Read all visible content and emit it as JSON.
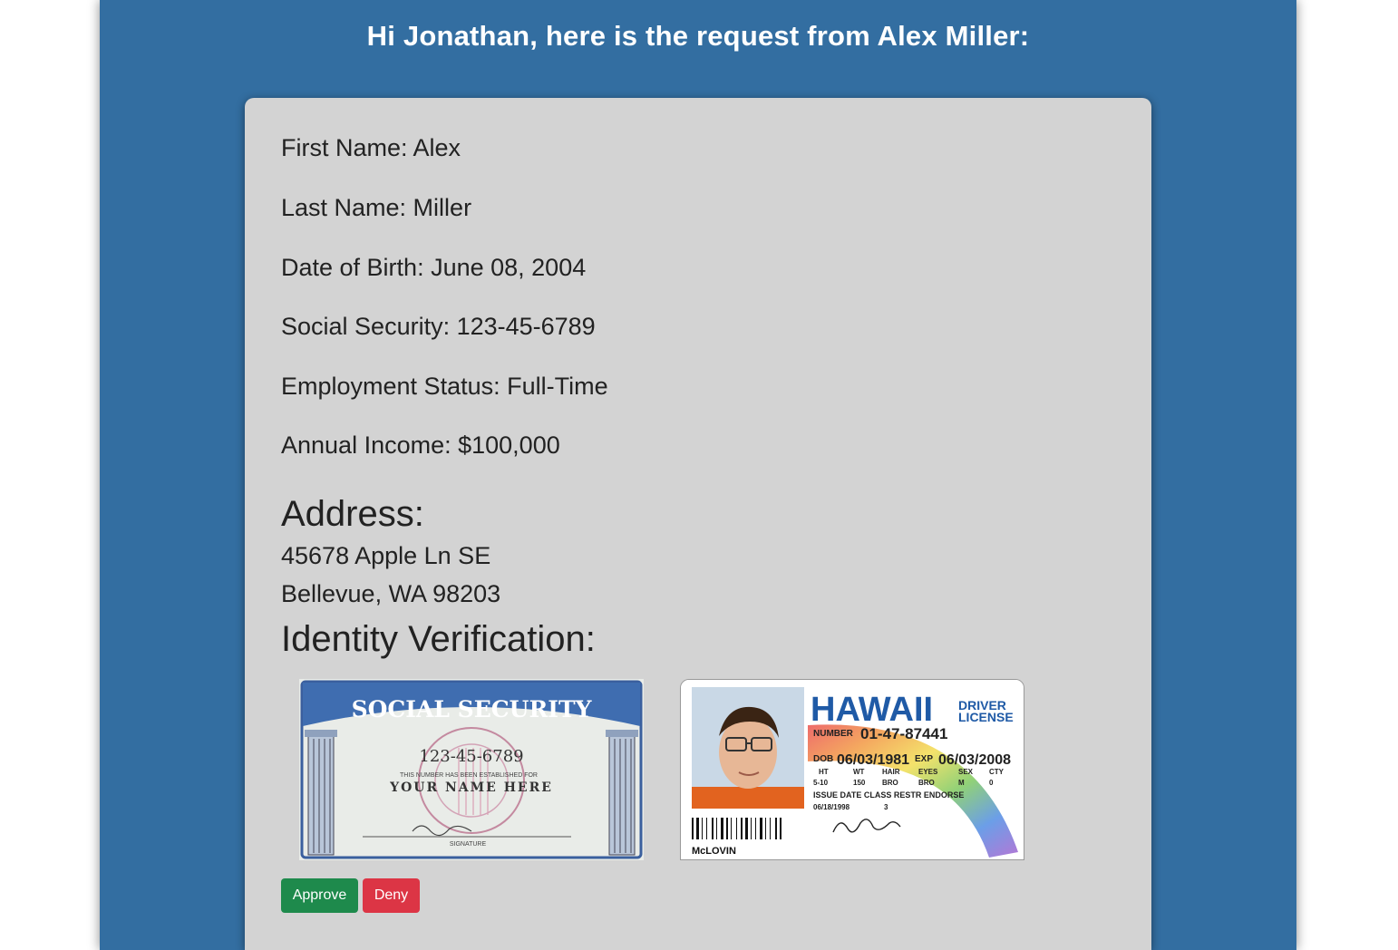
{
  "header": {
    "greeting": "Hi Jonathan, here is the request from Alex Miller:"
  },
  "applicant": {
    "first_name": "First Name: Alex",
    "last_name": "Last Name: Miller",
    "dob": "Date of Birth: June 08, 2004",
    "ssn": "Social Security: 123-45-6789",
    "employment": "Employment Status: Full-Time",
    "income": "Annual Income: $100,000"
  },
  "address": {
    "heading": "Address:",
    "line1": "45678 Apple Ln SE",
    "line2": "Bellevue, WA 98203"
  },
  "verification": {
    "heading": "Identity Verification:",
    "ssn_card": {
      "title": "SOCIAL SECURITY",
      "number": "123-45-6789",
      "note": "THIS NUMBER HAS BEEN ESTABLISHED FOR",
      "name": "YOUR NAME HERE",
      "sig_label": "SIGNATURE"
    },
    "license": {
      "state": "HAWAII",
      "type_line1": "DRIVER",
      "type_line2": "LICENSE",
      "number_label": "NUMBER",
      "number": "01-47-87441",
      "dob_label": "DOB",
      "dob": "06/03/1981",
      "exp_label": "EXP",
      "exp": "06/03/2008",
      "field_labels": [
        "HT",
        "WT",
        "HAIR",
        "EYES",
        "SEX",
        "CTY"
      ],
      "field_values": [
        "5-10",
        "150",
        "BRO",
        "BRO",
        "M",
        "0"
      ],
      "row3_labels": "ISSUE DATE  CLASS  RESTR  ENDORSE",
      "issue_date": "06/18/1998",
      "class": "3",
      "name": "McLOVIN"
    }
  },
  "actions": {
    "approve": "Approve",
    "deny": "Deny"
  },
  "colors": {
    "frame": "#336ea1",
    "card": "#d3d3d3",
    "approve": "#1e8a4c",
    "deny": "#dc3545"
  }
}
